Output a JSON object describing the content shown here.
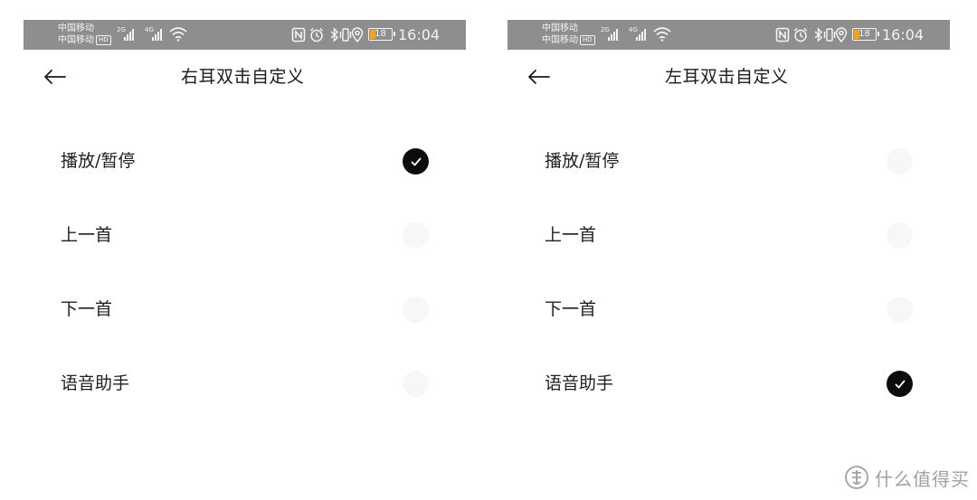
{
  "status_bar": {
    "carrier_1": "中国移动",
    "carrier_2": "中国移动",
    "hd_badge": "HD",
    "net_2g": "2G",
    "net_4g": "4G",
    "battery_level": "18",
    "time": "16:04",
    "battery_color": "#f0a22b"
  },
  "panels": [
    {
      "title": "右耳双击自定义",
      "options": [
        {
          "label": "播放/暂停",
          "selected": true
        },
        {
          "label": "上一首",
          "selected": false
        },
        {
          "label": "下一首",
          "selected": false
        },
        {
          "label": "语音助手",
          "selected": false
        }
      ]
    },
    {
      "title": "左耳双击自定义",
      "options": [
        {
          "label": "播放/暂停",
          "selected": false
        },
        {
          "label": "上一首",
          "selected": false
        },
        {
          "label": "下一首",
          "selected": false
        },
        {
          "label": "语音助手",
          "selected": true
        }
      ]
    }
  ],
  "icons": {
    "back": "arrow-left-icon",
    "nfc": "nfc-icon",
    "alarm": "alarm-icon",
    "bluetooth": "bluetooth-icon",
    "vibrate": "vibrate-icon",
    "location": "location-icon",
    "wifi": "wifi-icon",
    "check": "check-icon"
  },
  "watermark": {
    "text": "什么值得买"
  }
}
